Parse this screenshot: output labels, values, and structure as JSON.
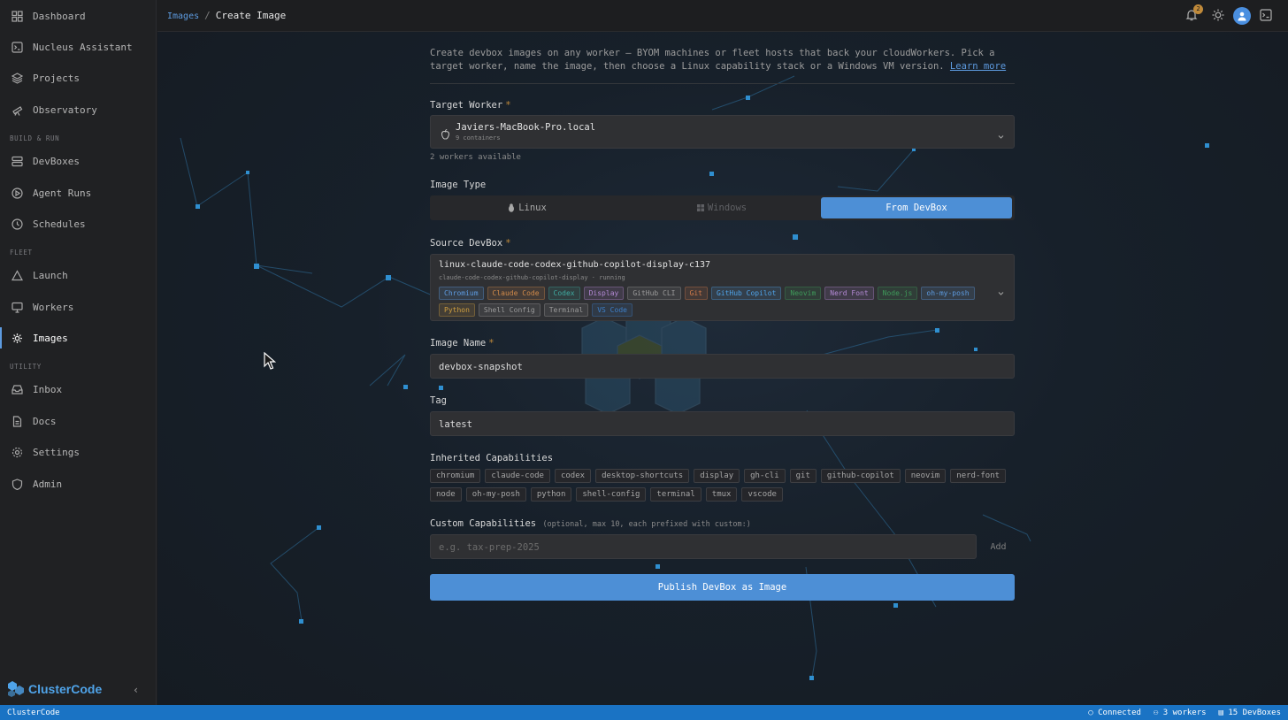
{
  "sidebar": {
    "items": [
      {
        "label": "Dashboard",
        "icon": "grid-icon"
      },
      {
        "label": "Nucleus Assistant",
        "icon": "terminal-icon"
      },
      {
        "label": "Projects",
        "icon": "layers-icon"
      },
      {
        "label": "Observatory",
        "icon": "telescope-icon"
      },
      {
        "label": "DevBoxes",
        "icon": "server-icon"
      },
      {
        "label": "Agent Runs",
        "icon": "play-circle-icon"
      },
      {
        "label": "Schedules",
        "icon": "clock-icon"
      },
      {
        "label": "Launch",
        "icon": "triangle-icon"
      },
      {
        "label": "Workers",
        "icon": "monitor-icon"
      },
      {
        "label": "Images",
        "icon": "gear-image-icon"
      },
      {
        "label": "Inbox",
        "icon": "inbox-icon"
      },
      {
        "label": "Docs",
        "icon": "document-icon"
      },
      {
        "label": "Settings",
        "icon": "settings-icon"
      },
      {
        "label": "Admin",
        "icon": "shield-icon"
      }
    ],
    "sections": [
      "BUILD & RUN",
      "FLEET",
      "UTILITY"
    ],
    "active": "Images",
    "brand_prefix": "Cluster",
    "brand_suffix": "Code"
  },
  "header": {
    "breadcrumb_parent": "Images",
    "breadcrumb_sep": "/",
    "breadcrumb_current": "Create Image",
    "notification_count": "2"
  },
  "form": {
    "intro_text": "Create devbox images on any worker — BYOM machines or fleet hosts that back your cloudWorkers. Pick a target worker, name the image, then choose a Linux capability stack or a Windows VM version.",
    "intro_link": "Learn more",
    "target_worker_label": "Target Worker",
    "required_mark": "*",
    "target_worker_name": "Javiers-MacBook-Pro.local",
    "target_worker_sub": "9 containers",
    "workers_available": "2 workers available",
    "image_type_label": "Image Type",
    "image_types": [
      "Linux",
      "Windows",
      "From DevBox"
    ],
    "image_type_selected": "From DevBox",
    "source_devbox_label": "Source DevBox",
    "source_devbox_name": "linux-claude-code-codex-github-copilot-display-c137",
    "source_devbox_sub": "claude-code-codex-github-copilot-display",
    "source_devbox_status": "running",
    "source_devbox_tags": [
      {
        "label": "Chromium",
        "color": "#5d9be0"
      },
      {
        "label": "Claude Code",
        "color": "#d08a4a"
      },
      {
        "label": "Codex",
        "color": "#3fa9a0"
      },
      {
        "label": "Display",
        "color": "#b48ad6"
      },
      {
        "label": "GitHub CLI",
        "color": "#9a9a9a"
      },
      {
        "label": "Git",
        "color": "#d07a4a"
      },
      {
        "label": "GitHub Copilot",
        "color": "#4fa3e8"
      },
      {
        "label": "Neovim",
        "color": "#3f9a5a"
      },
      {
        "label": "Nerd Font",
        "color": "#b48ad6"
      },
      {
        "label": "Node.js",
        "color": "#3f9a5a"
      },
      {
        "label": "oh-my-posh",
        "color": "#5d9be0"
      },
      {
        "label": "Python",
        "color": "#d0a040"
      },
      {
        "label": "Shell Config",
        "color": "#9a9a9a"
      },
      {
        "label": "Terminal",
        "color": "#9a9a9a"
      },
      {
        "label": "VS Code",
        "color": "#3d7fc8"
      }
    ],
    "image_name_label": "Image Name",
    "image_name_value": "devbox-snapshot",
    "tag_label": "Tag",
    "tag_value": "latest",
    "inherited_label": "Inherited Capabilities",
    "inherited_caps": [
      "chromium",
      "claude-code",
      "codex",
      "desktop-shortcuts",
      "display",
      "gh-cli",
      "git",
      "github-copilot",
      "neovim",
      "nerd-font",
      "node",
      "oh-my-posh",
      "python",
      "shell-config",
      "terminal",
      "tmux",
      "vscode"
    ],
    "custom_label": "Custom Capabilities",
    "custom_hint": "(optional, max 10, each prefixed with custom:)",
    "custom_placeholder": "e.g. tax-prep-2025",
    "add_label": "Add",
    "publish_label": "Publish DevBox as Image"
  },
  "statusbar": {
    "app": "ClusterCode",
    "connection": "Connected",
    "workers": "3 workers",
    "devboxes": "15 DevBoxes"
  },
  "colors": {
    "accent": "#4d8fd6",
    "statusbar": "#1a73c4",
    "required": "#c08a3a"
  }
}
